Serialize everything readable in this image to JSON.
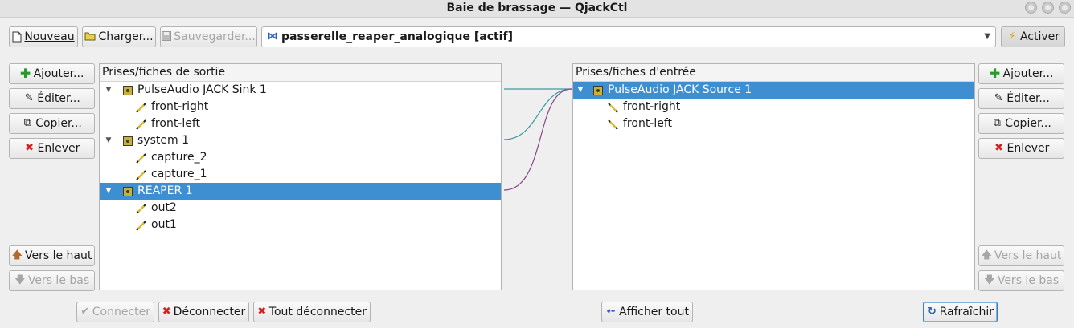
{
  "window": {
    "title": "Baie de brassage — QjackCtl"
  },
  "toolbar": {
    "new_label": "Nouveau",
    "load_label": "Charger...",
    "save_label": "Sauvegarder...",
    "patchbay_name": "passerelle_reaper_analogique [actif]",
    "activate_label": "Activer"
  },
  "outputs": {
    "header": "Prises/fiches de sortie",
    "clients": [
      {
        "name": "PulseAudio JACK Sink 1",
        "ports": [
          "front-right",
          "front-left"
        ]
      },
      {
        "name": "system 1",
        "ports": [
          "capture_2",
          "capture_1"
        ]
      },
      {
        "name": "REAPER 1",
        "ports": [
          "out2",
          "out1"
        ]
      }
    ]
  },
  "inputs": {
    "header": "Prises/fiches d'entrée",
    "clients": [
      {
        "name": "PulseAudio JACK Source 1",
        "ports": [
          "front-right",
          "front-left"
        ]
      }
    ]
  },
  "left_buttons": {
    "add": "Ajouter...",
    "edit": "Éditer...",
    "copy": "Copier...",
    "remove": "Enlever",
    "up": "Vers le haut",
    "down": "Vers le bas"
  },
  "right_buttons": {
    "add": "Ajouter...",
    "edit": "Éditer...",
    "copy": "Copier...",
    "remove": "Enlever",
    "up": "Vers le haut",
    "down": "Vers le bas"
  },
  "bottom": {
    "connect": "Connecter",
    "disconnect": "Déconnecter",
    "disconnect_all": "Tout déconnecter",
    "show_all": "Afficher tout",
    "refresh": "Rafraîchir"
  },
  "colors": {
    "selection": "#3d8fd1",
    "connection_teal": "#3a9a9a",
    "connection_purple": "#8a4a8a"
  }
}
